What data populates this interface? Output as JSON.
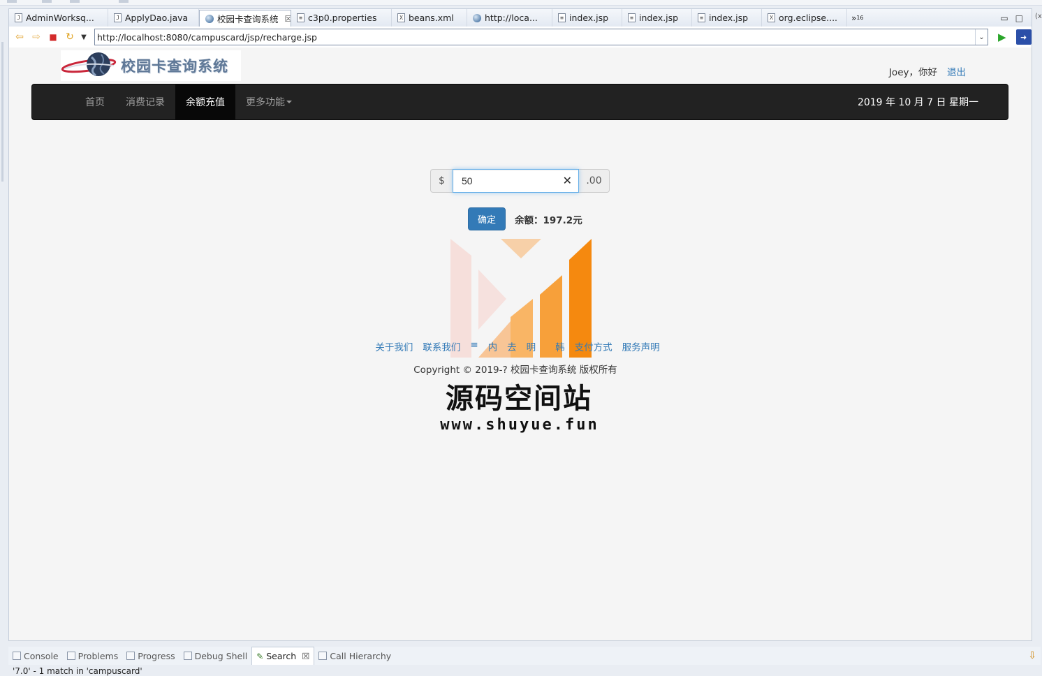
{
  "editor_tabs": [
    {
      "label": "AdminWorksq...",
      "icon": "java-file-icon",
      "glyph": "J"
    },
    {
      "label": "ApplyDao.java",
      "icon": "java-file-icon",
      "glyph": "J"
    },
    {
      "label": "校园卡查询系统",
      "icon": "browser-globe-icon",
      "active": true
    },
    {
      "label": "c3p0.properties",
      "icon": "text-file-icon",
      "glyph": "≡"
    },
    {
      "label": "beans.xml",
      "icon": "xml-file-icon",
      "glyph": "X"
    },
    {
      "label": "http://loca...",
      "icon": "browser-globe-icon"
    },
    {
      "label": "index.jsp",
      "icon": "jsp-file-icon",
      "glyph": "≡"
    },
    {
      "label": "index.jsp",
      "icon": "jsp-file-icon",
      "glyph": "≡"
    },
    {
      "label": "index.jsp",
      "icon": "jsp-file-icon",
      "glyph": "≡"
    },
    {
      "label": "org.eclipse....",
      "icon": "xml-file-icon",
      "glyph": "X"
    }
  ],
  "tab_overflow": {
    "label": "»",
    "count": "16"
  },
  "browser": {
    "url": "http://localhost:8080/campuscard/jsp/recharge.jsp"
  },
  "page": {
    "logo_text": "校园卡查询系统",
    "user_greeting": "Joey，你好",
    "logout": "退出",
    "nav": [
      {
        "label": "首页"
      },
      {
        "label": "消费记录"
      },
      {
        "label": "余额充值",
        "active": true
      },
      {
        "label": "更多功能",
        "dropdown": true
      }
    ],
    "date": "2019 年 10 月 7 日 星期一",
    "recharge": {
      "prefix": "$",
      "value": "50",
      "suffix": ".00",
      "clear": "✕"
    },
    "confirm": "确定",
    "balance": "余额：197.2元",
    "footer_links": [
      "关于我们",
      "联系我们",
      "≡",
      "内",
      "去",
      "明",
      "",
      "韩",
      "支付方式",
      "服务声明"
    ],
    "copyright": "Copyright © 2019-? 校园卡查询系统 版权所有",
    "watermark_title": "源码空间站",
    "watermark_url": "www.shuyue.fun"
  },
  "bottom_panel": {
    "tabs": [
      {
        "label": "Console"
      },
      {
        "label": "Problems"
      },
      {
        "label": "Progress"
      },
      {
        "label": "Debug Shell"
      },
      {
        "label": "Search",
        "active": true
      },
      {
        "label": "Call Hierarchy"
      }
    ],
    "status": "'7.0' - 1 match in 'campuscard'"
  },
  "colors": {
    "nav_bg": "#222222",
    "link": "#337ab7",
    "primary_button": "#337ab7",
    "watermark_orange": "#f5890f"
  }
}
